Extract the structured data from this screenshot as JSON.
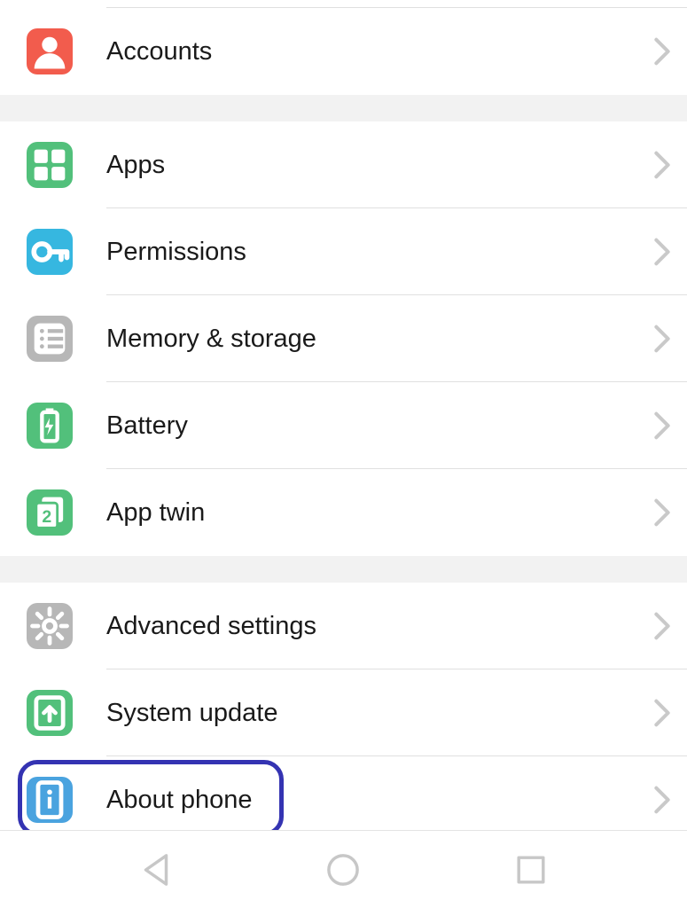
{
  "settings": {
    "group1": [
      {
        "id": "accounts",
        "label": "Accounts",
        "icon": "person-icon",
        "color": "#f25c4d"
      }
    ],
    "group2": [
      {
        "id": "apps",
        "label": "Apps",
        "icon": "apps-icon",
        "color": "#52c07b"
      },
      {
        "id": "permissions",
        "label": "Permissions",
        "icon": "key-icon",
        "color": "#36b7e0"
      },
      {
        "id": "memory",
        "label": "Memory & storage",
        "icon": "storage-icon",
        "color": "#b7b7b7"
      },
      {
        "id": "battery",
        "label": "Battery",
        "icon": "battery-icon",
        "color": "#52c07b"
      },
      {
        "id": "apptwin",
        "label": "App twin",
        "icon": "apptwin-icon",
        "color": "#52c07b"
      }
    ],
    "group3": [
      {
        "id": "advanced",
        "label": "Advanced settings",
        "icon": "gear-icon",
        "color": "#b7b7b7"
      },
      {
        "id": "sysupdate",
        "label": "System update",
        "icon": "update-icon",
        "color": "#52c07b"
      },
      {
        "id": "about",
        "label": "About phone",
        "icon": "info-icon",
        "color": "#4aa3df",
        "highlighted": true
      }
    ]
  },
  "navbar": [
    "back",
    "home",
    "recent"
  ]
}
